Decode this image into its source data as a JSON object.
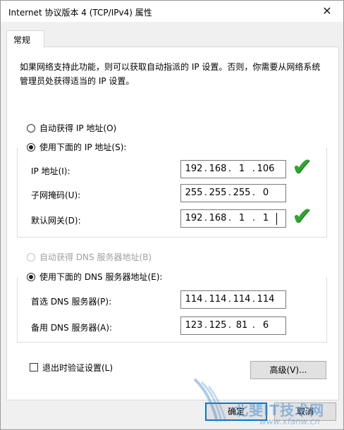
{
  "window": {
    "title": "Internet 协议版本 4 (TCP/IPv4) 属性",
    "close_glyph": "✕"
  },
  "tabs": [
    {
      "label": "常规",
      "selected": true
    }
  ],
  "description": "如果网络支持此功能，则可以获取自动指派的 IP 设置。否则，你需要从网络系统管理员处获得适当的 IP 设置。",
  "ip_section": {
    "auto_option": {
      "label": "自动获得 IP 地址(O)",
      "checked": false
    },
    "manual_option": {
      "label": "使用下面的 IP 地址(S):",
      "checked": true
    },
    "fields": [
      {
        "label": "IP 地址(I):",
        "octets": [
          "192",
          "168",
          "1",
          "106"
        ]
      },
      {
        "label": "子网掩码(U):",
        "octets": [
          "255",
          "255",
          "255",
          "0"
        ]
      },
      {
        "label": "默认网关(D):",
        "octets": [
          "192",
          "168",
          "1",
          "1"
        ]
      }
    ]
  },
  "dns_section": {
    "auto_option": {
      "label": "自动获得 DNS 服务器地址(B)",
      "checked": false,
      "disabled": true
    },
    "manual_option": {
      "label": "使用下面的 DNS 服务器地址(E):",
      "checked": true
    },
    "fields": [
      {
        "label": "首选 DNS 服务器(P):",
        "octets": [
          "114",
          "114",
          "114",
          "114"
        ]
      },
      {
        "label": "备用 DNS 服务器(A):",
        "octets": [
          "123",
          "125",
          "81",
          "6"
        ]
      }
    ]
  },
  "validate_checkbox": {
    "label": "退出时验证设置(L)",
    "checked": false
  },
  "advanced_button": "高级(V)...",
  "ok_button": "确定",
  "cancel_button": "取消",
  "annotations": {
    "checkmark_glyph": "✔",
    "checkmark_color": "#2fa62f"
  },
  "watermark": {
    "text": "北斐IT技术网",
    "url": "www.xfanw.cn"
  },
  "colors": {
    "accent": "#0078d7",
    "panel_bg": "#ffffff",
    "window_bg": "#f0f0f0"
  }
}
